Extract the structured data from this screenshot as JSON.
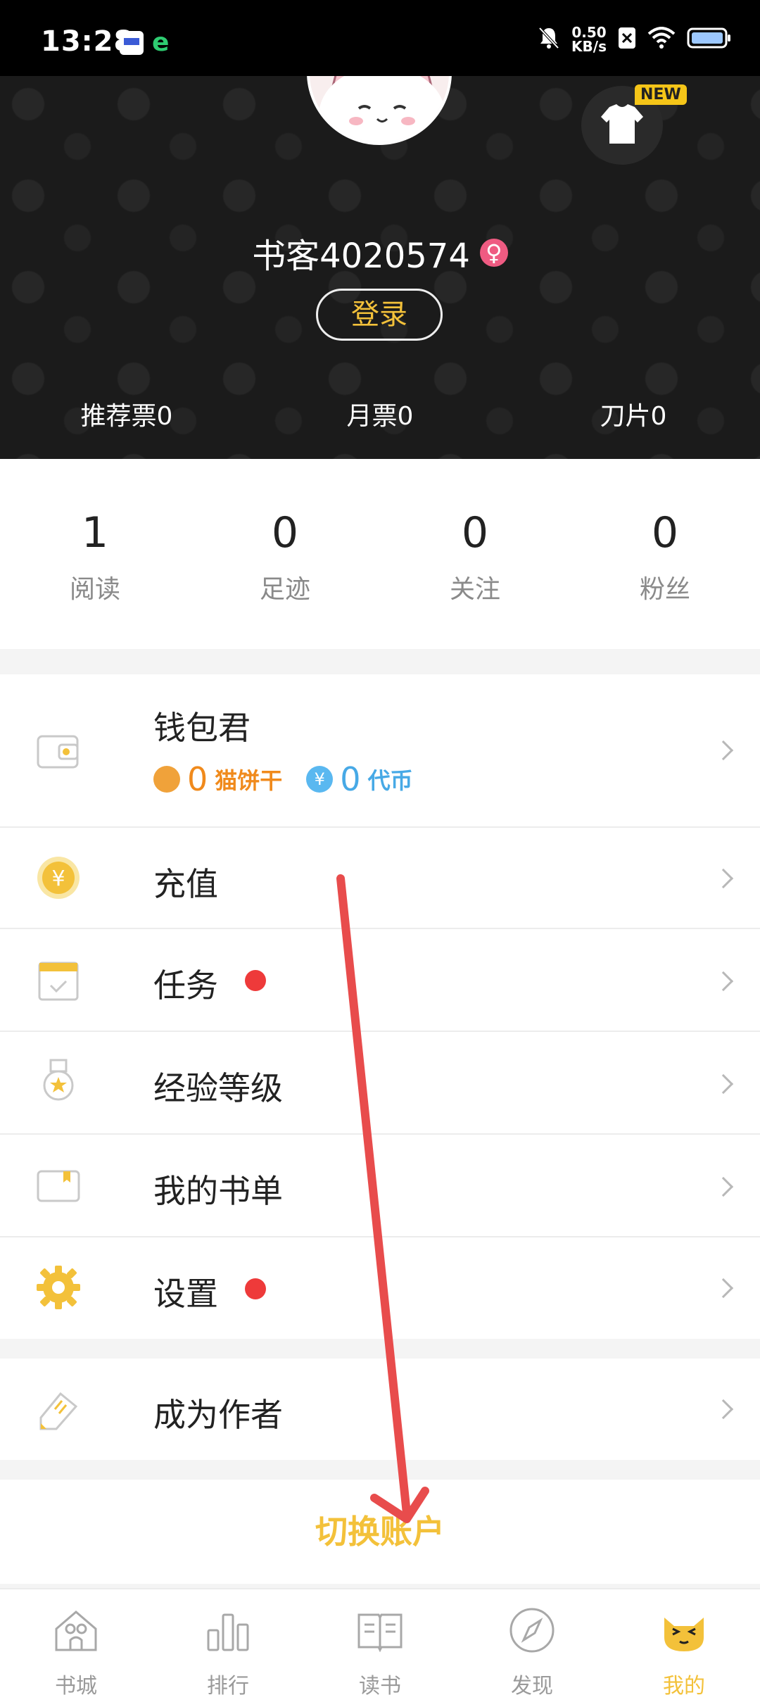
{
  "status_bar": {
    "time": "13:28",
    "net_speed_value": "0.50",
    "net_speed_unit": "KB/s"
  },
  "header": {
    "new_badge": "NEW",
    "username": "书客4020574",
    "gender_symbol": "♀",
    "login_label": "登录",
    "tickets": [
      {
        "label": "推荐票0"
      },
      {
        "label": "月票0"
      },
      {
        "label": "刀片0"
      }
    ]
  },
  "stats": [
    {
      "value": "1",
      "label": "阅读"
    },
    {
      "value": "0",
      "label": "足迹"
    },
    {
      "value": "0",
      "label": "关注"
    },
    {
      "value": "0",
      "label": "粉丝"
    }
  ],
  "wallet": {
    "title": "钱包君",
    "cookie_value": "0",
    "cookie_label": "猫饼干",
    "coin_symbol": "¥",
    "coin_value": "0",
    "coin_label": "代币"
  },
  "menu": {
    "recharge": "充值",
    "recharge_symbol": "¥",
    "tasks": "任务",
    "level": "经验等级",
    "booklist": "我的书单",
    "settings": "设置",
    "author": "成为作者"
  },
  "switch_account": "切换账户",
  "bottom_nav": [
    {
      "label": "书城",
      "icon": "store-icon",
      "active": false
    },
    {
      "label": "排行",
      "icon": "ranking-icon",
      "active": false
    },
    {
      "label": "读书",
      "icon": "book-icon",
      "active": false
    },
    {
      "label": "发现",
      "icon": "compass-icon",
      "active": false
    },
    {
      "label": "我的",
      "icon": "cat-face-icon",
      "active": true
    }
  ],
  "colors": {
    "accent": "#f3c13a",
    "dot": "#ee3a3a",
    "arrow": "#e84c4c"
  }
}
